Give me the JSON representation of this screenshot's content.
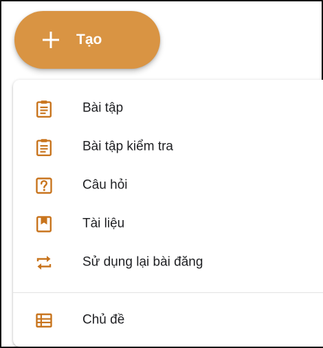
{
  "create_button": {
    "label": "Tạo",
    "icon": "plus-icon"
  },
  "menu": {
    "items": [
      {
        "label": "Bài tập",
        "icon": "assignment-clipboard-icon"
      },
      {
        "label": "Bài tập kiểm tra",
        "icon": "quiz-assignment-icon"
      },
      {
        "label": "Câu hỏi",
        "icon": "question-icon"
      },
      {
        "label": "Tài liệu",
        "icon": "material-bookmark-icon"
      },
      {
        "label": "Sử dụng lại bài đăng",
        "icon": "reuse-post-icon"
      }
    ],
    "topic": {
      "label": "Chủ đề",
      "icon": "topic-list-icon"
    }
  },
  "colors": {
    "accent": "#d99443",
    "icon": "#c8741d",
    "text": "#202124",
    "button_text": "#ffffff"
  }
}
